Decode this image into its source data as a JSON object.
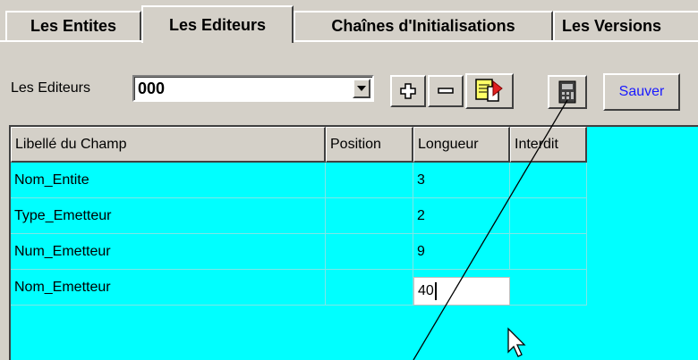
{
  "tabs": [
    {
      "label": "Les Entites"
    },
    {
      "label": "Les Editeurs",
      "active": true
    },
    {
      "label": "Chaînes d'Initialisations"
    },
    {
      "label": "Les Versions"
    }
  ],
  "toolbar": {
    "editeurs_label": "Les Editeurs",
    "editeurs_value": "000",
    "add_icon": "plus-icon",
    "remove_icon": "minus-icon",
    "copy_icon": "copy-record-icon",
    "calc_icon": "calculator-icon",
    "save_label": "Sauver"
  },
  "grid": {
    "columns": [
      "Libellé du Champ",
      "Position",
      "Longueur",
      "Interdit"
    ],
    "rows": [
      {
        "libelle": "Nom_Entite",
        "position": "",
        "longueur": "3",
        "interdit": ""
      },
      {
        "libelle": "Type_Emetteur",
        "position": "",
        "longueur": "2",
        "interdit": ""
      },
      {
        "libelle": "Num_Emetteur",
        "position": "",
        "longueur": "9",
        "interdit": ""
      },
      {
        "libelle": "Nom_Emetteur",
        "position": "",
        "longueur": "40",
        "interdit": ""
      }
    ]
  },
  "colors": {
    "grid_background": "#00ffff",
    "window_background": "#d4d0c8",
    "save_text": "#1a1aff"
  }
}
